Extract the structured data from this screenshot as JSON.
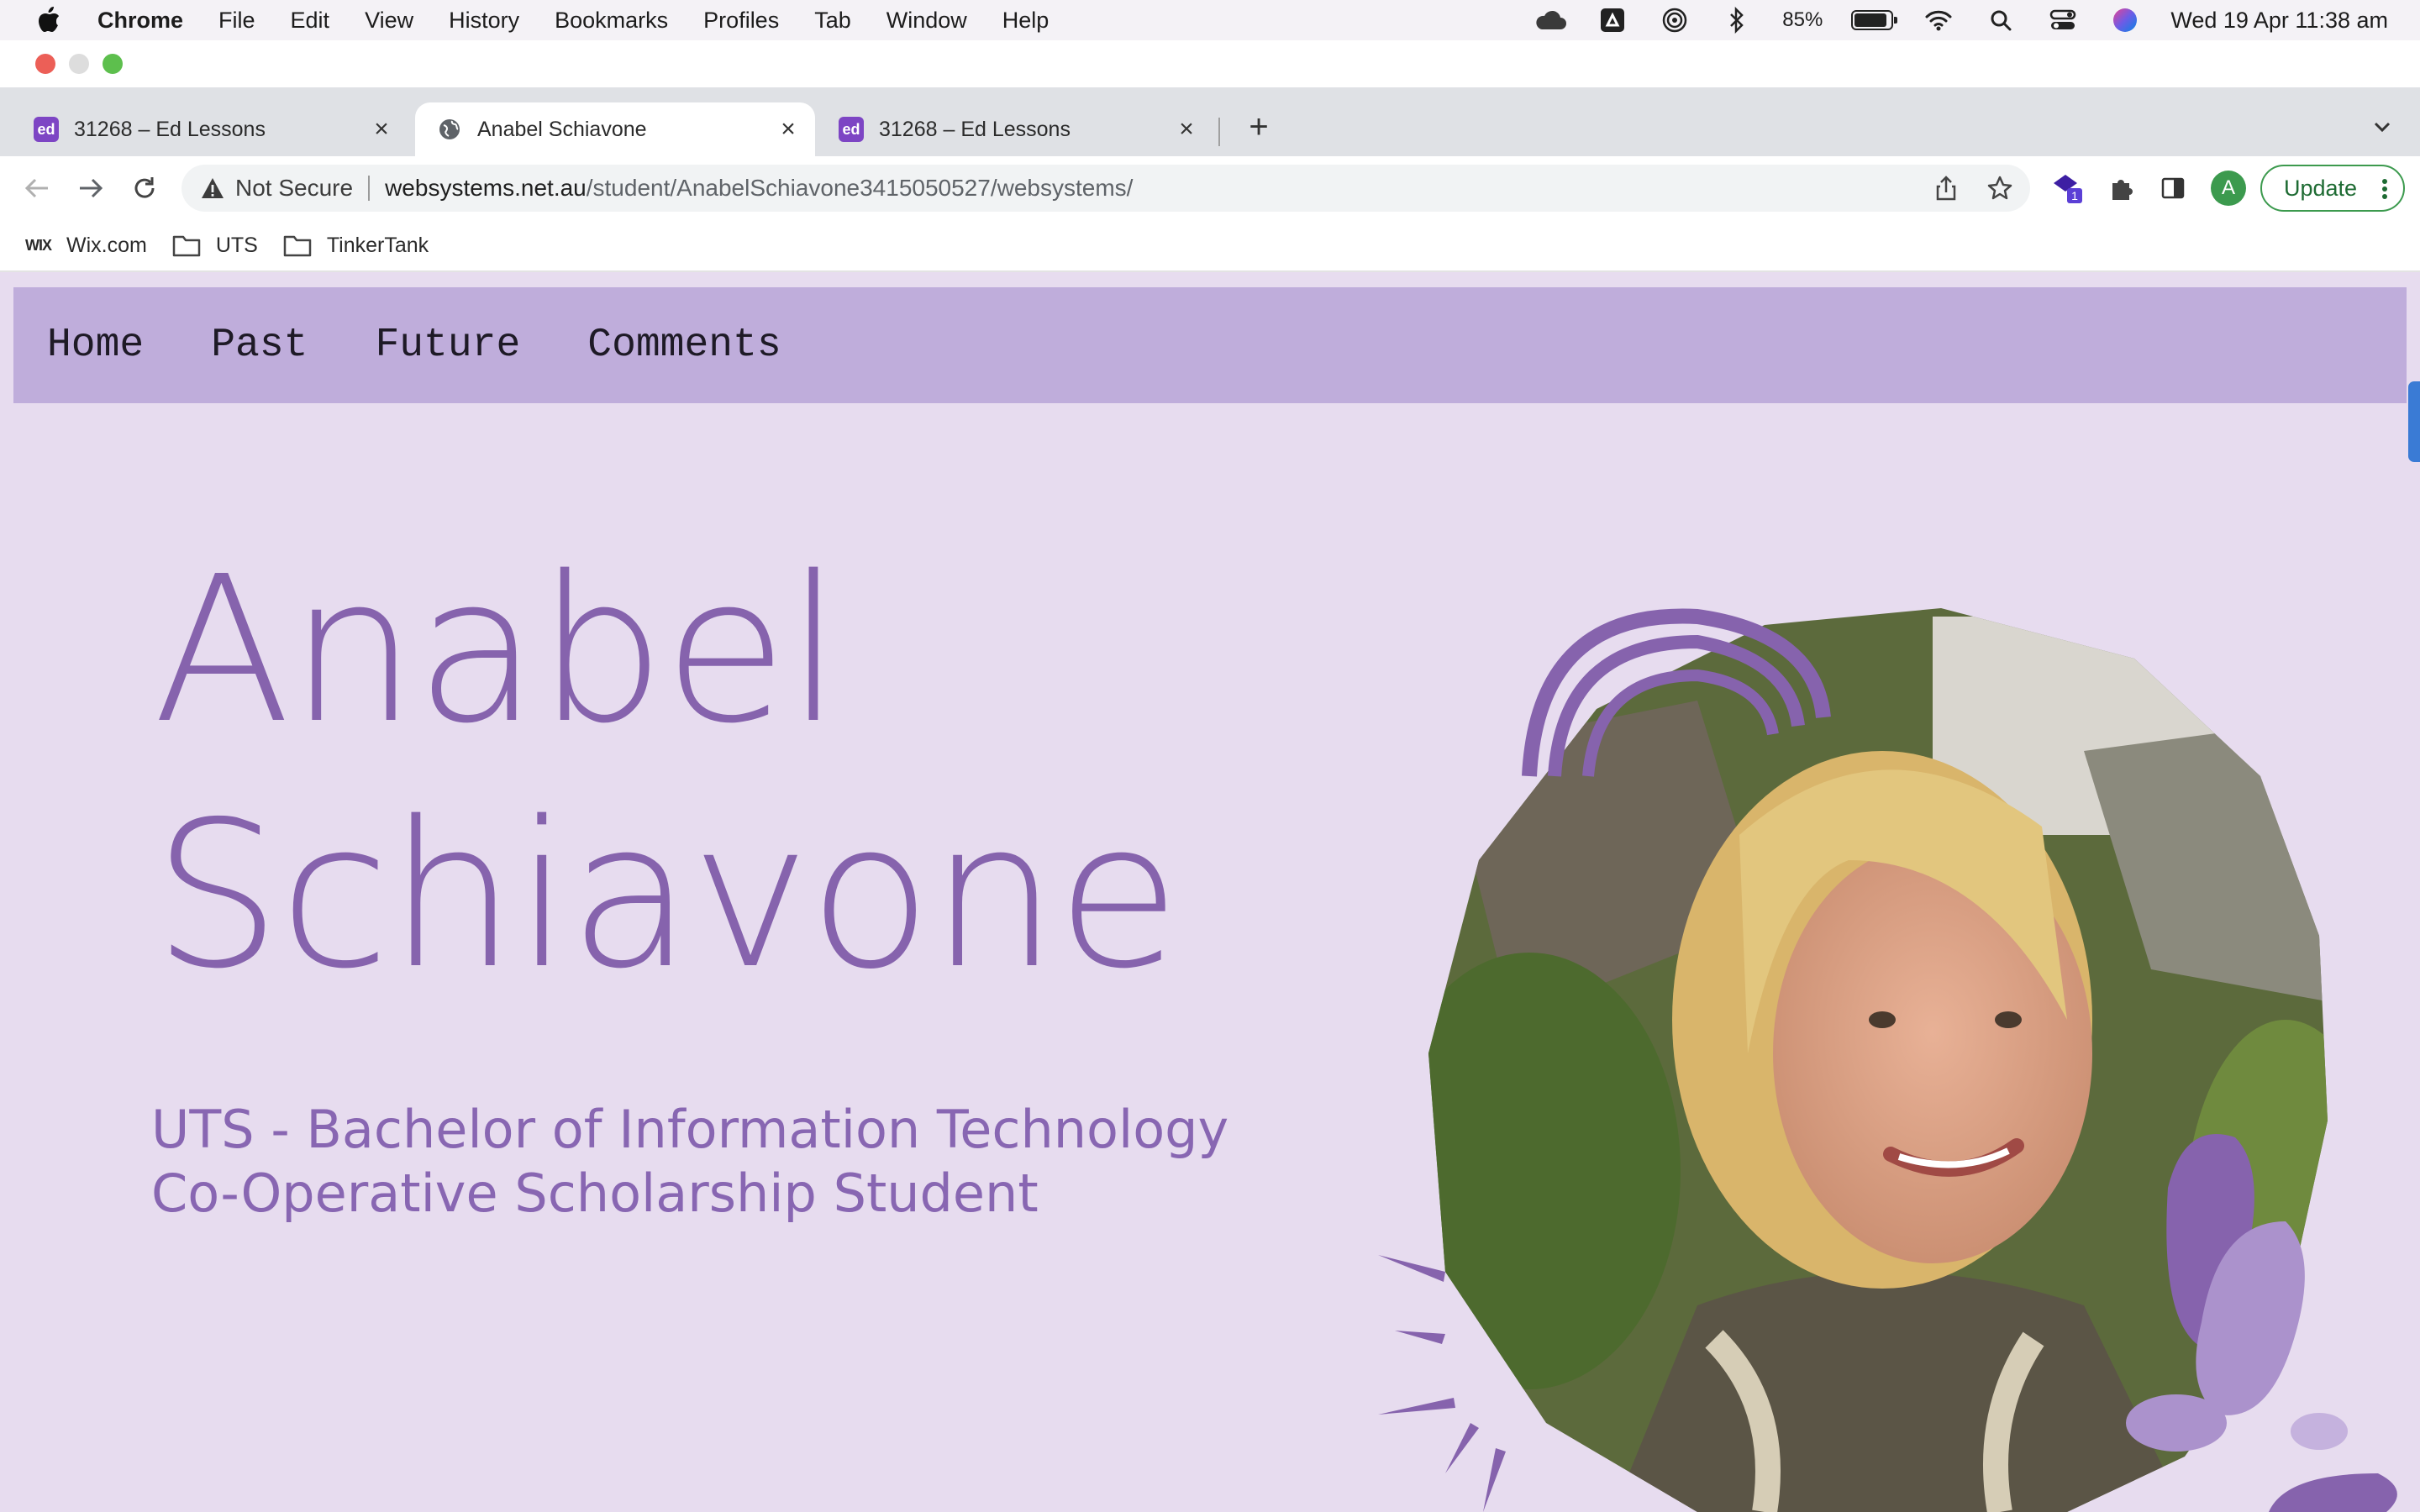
{
  "menubar": {
    "app_name": "Chrome",
    "menus": [
      "File",
      "Edit",
      "View",
      "History",
      "Bookmarks",
      "Profiles",
      "Tab",
      "Window",
      "Help"
    ],
    "battery_percent": "85%",
    "datetime": "Wed 19 Apr  11:38 am"
  },
  "tabs": [
    {
      "title": "31268 – Ed Lessons",
      "favicon": "ed",
      "active": false
    },
    {
      "title": "Anabel Schiavone",
      "favicon": "globe-icon",
      "active": true
    },
    {
      "title": "31268 – Ed Lessons",
      "favicon": "ed",
      "active": false
    }
  ],
  "omnibox": {
    "security_label": "Not Secure",
    "host": "websystems.net.au",
    "path": "/student/AnabelSchiavone3415050527/websystems/"
  },
  "toolbar": {
    "extension_badge": "1",
    "profile_initial": "A",
    "update_label": "Update"
  },
  "bookmarks": [
    {
      "label": "Wix.com",
      "icon": "WIX"
    },
    {
      "label": "UTS",
      "icon": "folder-icon"
    },
    {
      "label": "TinkerTank",
      "icon": "folder-icon"
    }
  ],
  "site": {
    "nav": [
      "Home",
      "Past",
      "Future",
      "Comments"
    ],
    "name_first": "Anabel",
    "name_last": "Schiavone",
    "subtitle_line1": "UTS - Bachelor of Information Technology",
    "subtitle_line2": "Co-Operative Scholarship Student"
  },
  "colors": {
    "nav_bg": "#bfaddb",
    "page_bg": "#e7dcef",
    "accent_purple": "#8663ad"
  }
}
